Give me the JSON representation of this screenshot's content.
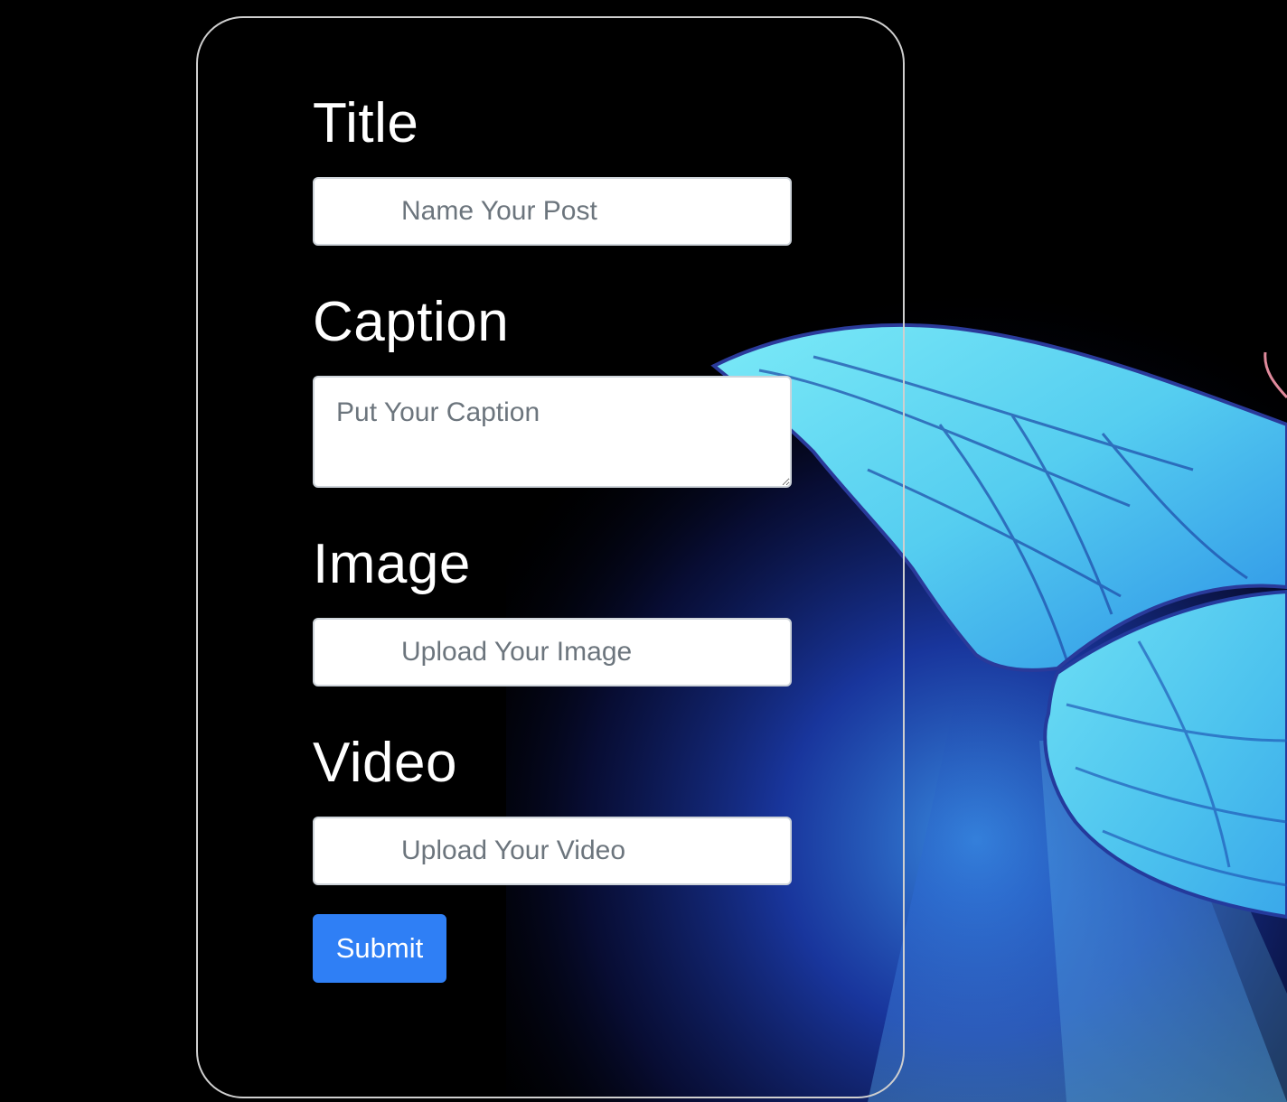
{
  "form": {
    "title": {
      "label": "Title",
      "placeholder": "Name Your Post"
    },
    "caption": {
      "label": "Caption",
      "placeholder": "Put Your Caption"
    },
    "image": {
      "label": "Image",
      "placeholder": "Upload Your Image"
    },
    "video": {
      "label": "Video",
      "placeholder": "Upload Your Video"
    },
    "submit_label": "Submit"
  },
  "colors": {
    "background": "#000000",
    "card_border": "#cfcfcf",
    "submit_button": "#2f7ff5",
    "wing_light": "#6fe4f5",
    "wing_dark": "#1b4fd8"
  }
}
